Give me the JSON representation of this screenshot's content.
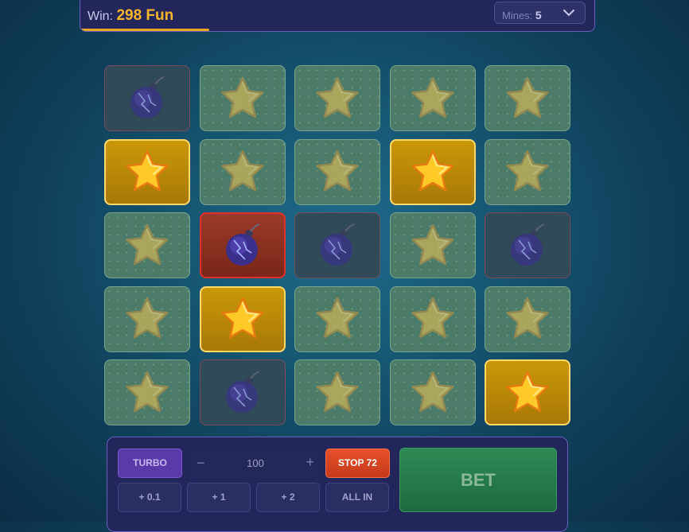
{
  "header": {
    "win_label": "Win:",
    "win_amount": "298 Fun",
    "progress_fraction": 0.25,
    "mines_label": "Mines:",
    "mines_value": "5"
  },
  "board": {
    "rows": 5,
    "cols": 5,
    "tiles": [
      "bomb-dim",
      "star-hidden",
      "star-hidden",
      "star-hidden",
      "star-hidden",
      "star-gold",
      "star-hidden",
      "star-hidden",
      "star-gold",
      "star-hidden",
      "star-hidden",
      "bomb-hit",
      "bomb-dim",
      "star-hidden",
      "bomb-dim",
      "star-hidden",
      "star-gold",
      "star-hidden",
      "star-hidden",
      "star-hidden",
      "star-hidden",
      "bomb-dim",
      "star-hidden",
      "star-hidden",
      "star-gold"
    ]
  },
  "controls": {
    "turbo_label": "TURBO",
    "minus_symbol": "−",
    "amount_value": "100",
    "plus_symbol": "+",
    "stop_label": "STOP 72",
    "inc_01": "+ 0.1",
    "inc_1": "+ 1",
    "inc_2": "+ 2",
    "all_in": "ALL IN",
    "bet_label": "BET"
  },
  "colors": {
    "accent_gold": "#f7b52a",
    "bet_green": "#2e8a55",
    "stop_red": "#e8502a",
    "turbo_purple": "#5a3aa8"
  }
}
